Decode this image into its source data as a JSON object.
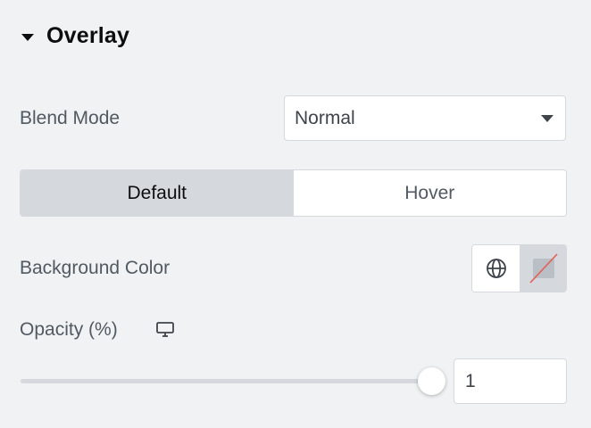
{
  "section": {
    "title": "Overlay",
    "expanded": true,
    "icon": "caret-down-icon"
  },
  "blend_mode": {
    "label": "Blend Mode",
    "value": "Normal",
    "icon": "chevron-down-icon"
  },
  "state_tabs": {
    "items": [
      {
        "label": "Default",
        "active": true
      },
      {
        "label": "Hover",
        "active": false
      }
    ]
  },
  "background_color": {
    "label": "Background Color",
    "global_icon": "globe-icon",
    "swatch_state": "none",
    "swatch_color": "#babfc5",
    "slash_color": "#e55d55"
  },
  "opacity": {
    "label": "Opacity (%)",
    "device_icon": "desktop-icon",
    "value": "1",
    "slider_position": 1.0
  },
  "colors": {
    "panel_bg": "#f1f2f3",
    "border": "#d5d8dc",
    "active_tab_bg": "#d5d8dc",
    "text": "#3f444b",
    "heading": "#0c0d0e"
  }
}
